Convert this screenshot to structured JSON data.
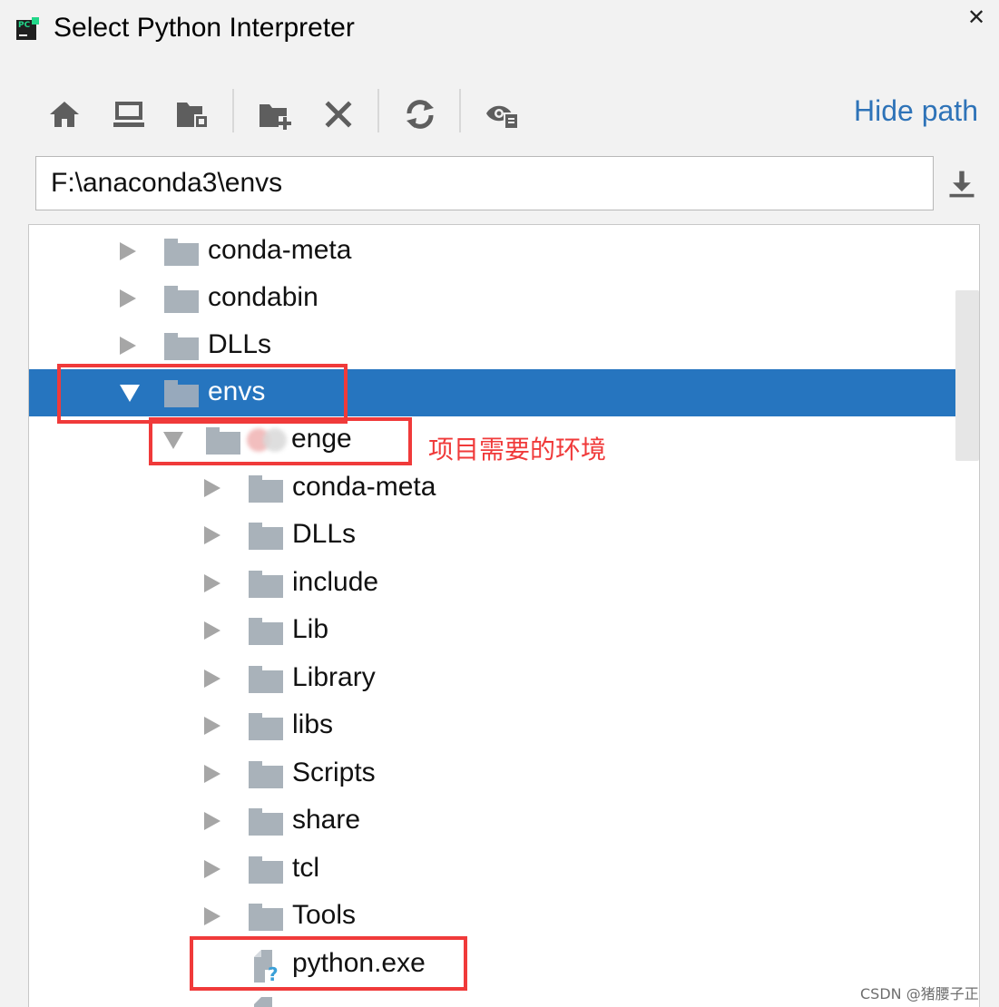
{
  "window": {
    "title": "Select Python Interpreter",
    "app_icon": "pycharm-icon",
    "close_icon": "close-icon",
    "close_glyph": "✕"
  },
  "toolbar": {
    "items": [
      {
        "name": "home-icon"
      },
      {
        "name": "desktop-icon"
      },
      {
        "name": "project-folder-icon"
      },
      {
        "name": "new-folder-icon"
      },
      {
        "name": "delete-icon"
      },
      {
        "name": "refresh-icon"
      },
      {
        "name": "show-hidden-files-icon"
      }
    ],
    "hide_path_label": "Hide path"
  },
  "path": {
    "value": "F:\\anaconda3\\envs",
    "download_icon": "download-icon"
  },
  "tree": {
    "rows": [
      {
        "label": "conda-meta",
        "type": "folder",
        "expanded": false,
        "selected": false
      },
      {
        "label": "condabin",
        "type": "folder",
        "expanded": false,
        "selected": false
      },
      {
        "label": "DLLs",
        "type": "folder",
        "expanded": false,
        "selected": false
      },
      {
        "label": "envs",
        "type": "folder",
        "expanded": true,
        "selected": true
      },
      {
        "label": "enge",
        "type": "folder",
        "expanded": true,
        "selected": false,
        "obscured": true
      },
      {
        "label": "conda-meta",
        "type": "folder",
        "expanded": false,
        "selected": false
      },
      {
        "label": "DLLs",
        "type": "folder",
        "expanded": false,
        "selected": false
      },
      {
        "label": "include",
        "type": "folder",
        "expanded": false,
        "selected": false
      },
      {
        "label": "Lib",
        "type": "folder",
        "expanded": false,
        "selected": false
      },
      {
        "label": "Library",
        "type": "folder",
        "expanded": false,
        "selected": false
      },
      {
        "label": "libs",
        "type": "folder",
        "expanded": false,
        "selected": false
      },
      {
        "label": "Scripts",
        "type": "folder",
        "expanded": false,
        "selected": false
      },
      {
        "label": "share",
        "type": "folder",
        "expanded": false,
        "selected": false
      },
      {
        "label": "tcl",
        "type": "folder",
        "expanded": false,
        "selected": false
      },
      {
        "label": "Tools",
        "type": "folder",
        "expanded": false,
        "selected": false
      },
      {
        "label": "python.exe",
        "type": "file",
        "expanded": false,
        "selected": false
      }
    ]
  },
  "annotation": {
    "text": "项目需要的环境",
    "color": "#f03a3a"
  },
  "watermark": "CSDN @猪腰子正",
  "colors": {
    "selection": "#2675bf",
    "link": "#2e73b8",
    "annotation_red": "#f03a3a"
  }
}
